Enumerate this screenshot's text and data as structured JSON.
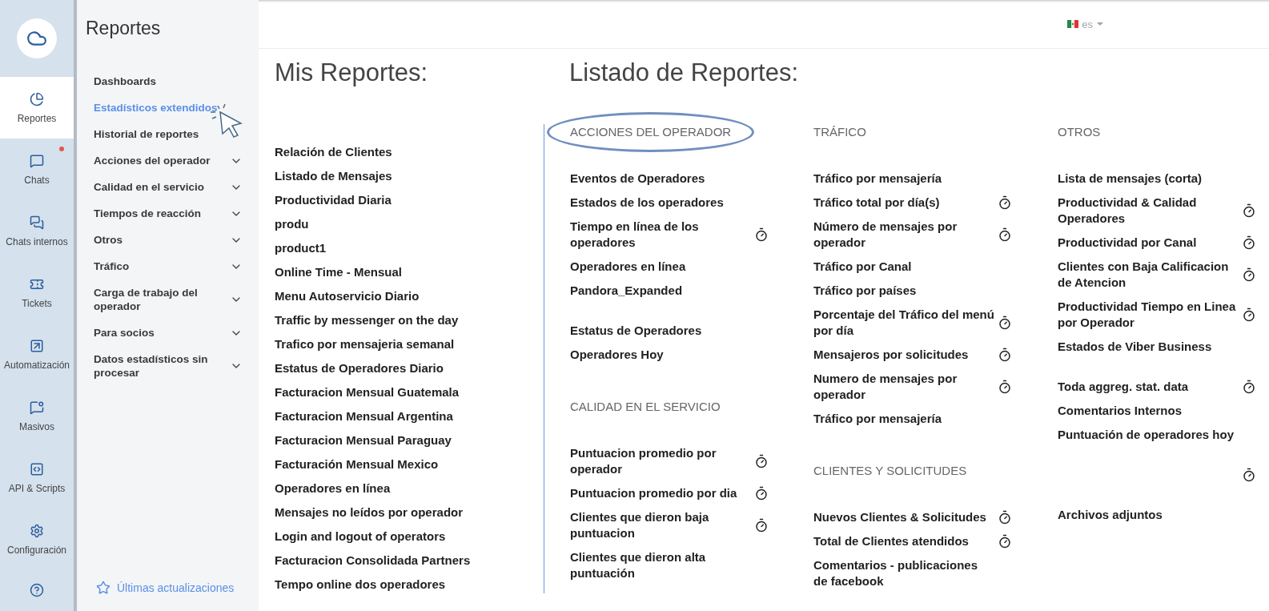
{
  "rail": {
    "items": [
      {
        "label": "Reportes",
        "selected": true,
        "notification": false
      },
      {
        "label": "Chats",
        "selected": false,
        "notification": true
      },
      {
        "label": "Chats internos",
        "selected": false,
        "notification": false
      },
      {
        "label": "Tickets",
        "selected": false,
        "notification": false
      },
      {
        "label": "Automatización",
        "selected": false,
        "notification": false
      },
      {
        "label": "Masivos",
        "selected": false,
        "notification": false
      },
      {
        "label": "API & Scripts",
        "selected": false,
        "notification": false
      },
      {
        "label": "Configuración",
        "selected": false,
        "notification": false
      }
    ]
  },
  "sidebar": {
    "title": "Reportes",
    "items": [
      {
        "label": "Dashboards",
        "selected": false,
        "expandable": false
      },
      {
        "label": "Estadísticos extendidos",
        "selected": true,
        "expandable": false
      },
      {
        "label": "Historial de reportes",
        "selected": false,
        "expandable": false
      },
      {
        "label": "Acciones del operador",
        "selected": false,
        "expandable": true
      },
      {
        "label": "Calidad en el servicio",
        "selected": false,
        "expandable": true
      },
      {
        "label": "Tiempos de reacción",
        "selected": false,
        "expandable": true
      },
      {
        "label": "Otros",
        "selected": false,
        "expandable": true
      },
      {
        "label": "Tráfico",
        "selected": false,
        "expandable": true
      },
      {
        "label": "Carga de trabajo del operador",
        "selected": false,
        "expandable": true
      },
      {
        "label": "Para socios",
        "selected": false,
        "expandable": true
      },
      {
        "label": "Datos estadísticos sin procesar",
        "selected": false,
        "expandable": true
      }
    ],
    "footer_link": "Últimas actualizaciones"
  },
  "topbar": {
    "language": "es"
  },
  "my_reports": {
    "title": "Mis Reportes:",
    "items": [
      "Relación de Clientes",
      "Listado de Mensajes",
      "Productividad Diaria",
      "produ",
      "product1",
      "Online Time - Mensual",
      "Menu Autoservicio Diario",
      "Traffic by messenger on the day",
      "Trafico por mensajeria semanal",
      "Estatus de Operadores Diario",
      "Facturacion Mensual Guatemala",
      "Facturacion Mensual Argentina",
      "Facturacion Mensual Paraguay",
      "Facturación Mensual Mexico",
      "Operadores en línea",
      "Mensajes no leídos por operador",
      "Login and logout of operators",
      "Facturacion Consolidada Partners",
      "Tempo online dos operadores"
    ]
  },
  "report_list": {
    "title": "Listado de Reportes:",
    "columns": [
      {
        "sections": [
          {
            "title": "ACCIONES DEL OPERADOR",
            "highlighted": true,
            "items": [
              {
                "kind": "report",
                "name": "Eventos de Operadores",
                "timer": false
              },
              {
                "kind": "report",
                "name": "Estados de los operadores",
                "timer": false
              },
              {
                "kind": "report",
                "name": "Tiempo en línea de los operadores",
                "timer": true
              },
              {
                "kind": "report",
                "name": "Operadores en línea",
                "timer": false
              },
              {
                "kind": "report",
                "name": "Pandora_Expanded",
                "timer": false
              },
              {
                "kind": "spacer"
              },
              {
                "kind": "report",
                "name": "Estatus de Operadores",
                "timer": false
              },
              {
                "kind": "report",
                "name": "Operadores Hoy",
                "timer": false
              }
            ]
          },
          {
            "title": "CALIDAD EN EL SERVICIO",
            "highlighted": false,
            "items": [
              {
                "kind": "report",
                "name": "Puntuacion promedio por operador",
                "timer": true
              },
              {
                "kind": "report",
                "name": "Puntuacion promedio por dia",
                "timer": true
              },
              {
                "kind": "report",
                "name": "Clientes que dieron baja puntuacion",
                "timer": true
              },
              {
                "kind": "report",
                "name": "Clientes que dieron alta puntuación",
                "timer": false
              }
            ]
          }
        ]
      },
      {
        "sections": [
          {
            "title": "TRÁFICO",
            "highlighted": false,
            "items": [
              {
                "kind": "report",
                "name": "Tráfico por mensajería",
                "timer": false
              },
              {
                "kind": "report",
                "name": "Tráfico total por día(s)",
                "timer": true
              },
              {
                "kind": "report",
                "name": "Número de mensajes por operador",
                "timer": true
              },
              {
                "kind": "report",
                "name": "Tráfico por Canal",
                "timer": false
              },
              {
                "kind": "report",
                "name": "Tráfico por países",
                "timer": false
              },
              {
                "kind": "report",
                "name": "Porcentaje del Tráfico del menú por día",
                "timer": true
              },
              {
                "kind": "report",
                "name": "Mensajeros por solicitudes",
                "timer": true
              },
              {
                "kind": "report",
                "name": "Numero de mensajes por operador",
                "timer": true
              },
              {
                "kind": "report",
                "name": "Tráfico por mensajería",
                "timer": false
              }
            ]
          },
          {
            "title": "CLIENTES Y SOLICITUDES",
            "highlighted": false,
            "items": [
              {
                "kind": "report",
                "name": "Nuevos Clientes & Solicitudes",
                "timer": true
              },
              {
                "kind": "report",
                "name": "Total de Clientes atendidos",
                "timer": true
              },
              {
                "kind": "report",
                "name": "Comentarios - publicaciones de facebook",
                "timer": false
              }
            ]
          }
        ]
      },
      {
        "sections": [
          {
            "title": "OTROS",
            "highlighted": false,
            "items": [
              {
                "kind": "report",
                "name": "Lista de mensajes (corta)",
                "timer": false
              },
              {
                "kind": "report",
                "name": "Productividad & Calidad Operadores",
                "timer": true
              },
              {
                "kind": "report",
                "name": "Productividad por Canal",
                "timer": true
              },
              {
                "kind": "report",
                "name": "Clientes con Baja Calificacion de Atencion",
                "timer": true
              },
              {
                "kind": "report",
                "name": "Productividad Tiempo en Linea por Operador",
                "timer": true
              },
              {
                "kind": "report",
                "name": "Estados de Viber Business",
                "timer": false
              },
              {
                "kind": "spacer"
              },
              {
                "kind": "report",
                "name": "Toda aggreg. stat. data",
                "timer": true
              },
              {
                "kind": "report",
                "name": "Comentarios Internos",
                "timer": false
              },
              {
                "kind": "report",
                "name": "Puntuación de operadores hoy",
                "timer": false
              },
              {
                "kind": "spacer"
              },
              {
                "kind": "report",
                "timer": true
              },
              {
                "kind": "spacer"
              },
              {
                "kind": "report",
                "name": "Archivos adjuntos",
                "timer": false
              }
            ]
          }
        ]
      }
    ]
  }
}
